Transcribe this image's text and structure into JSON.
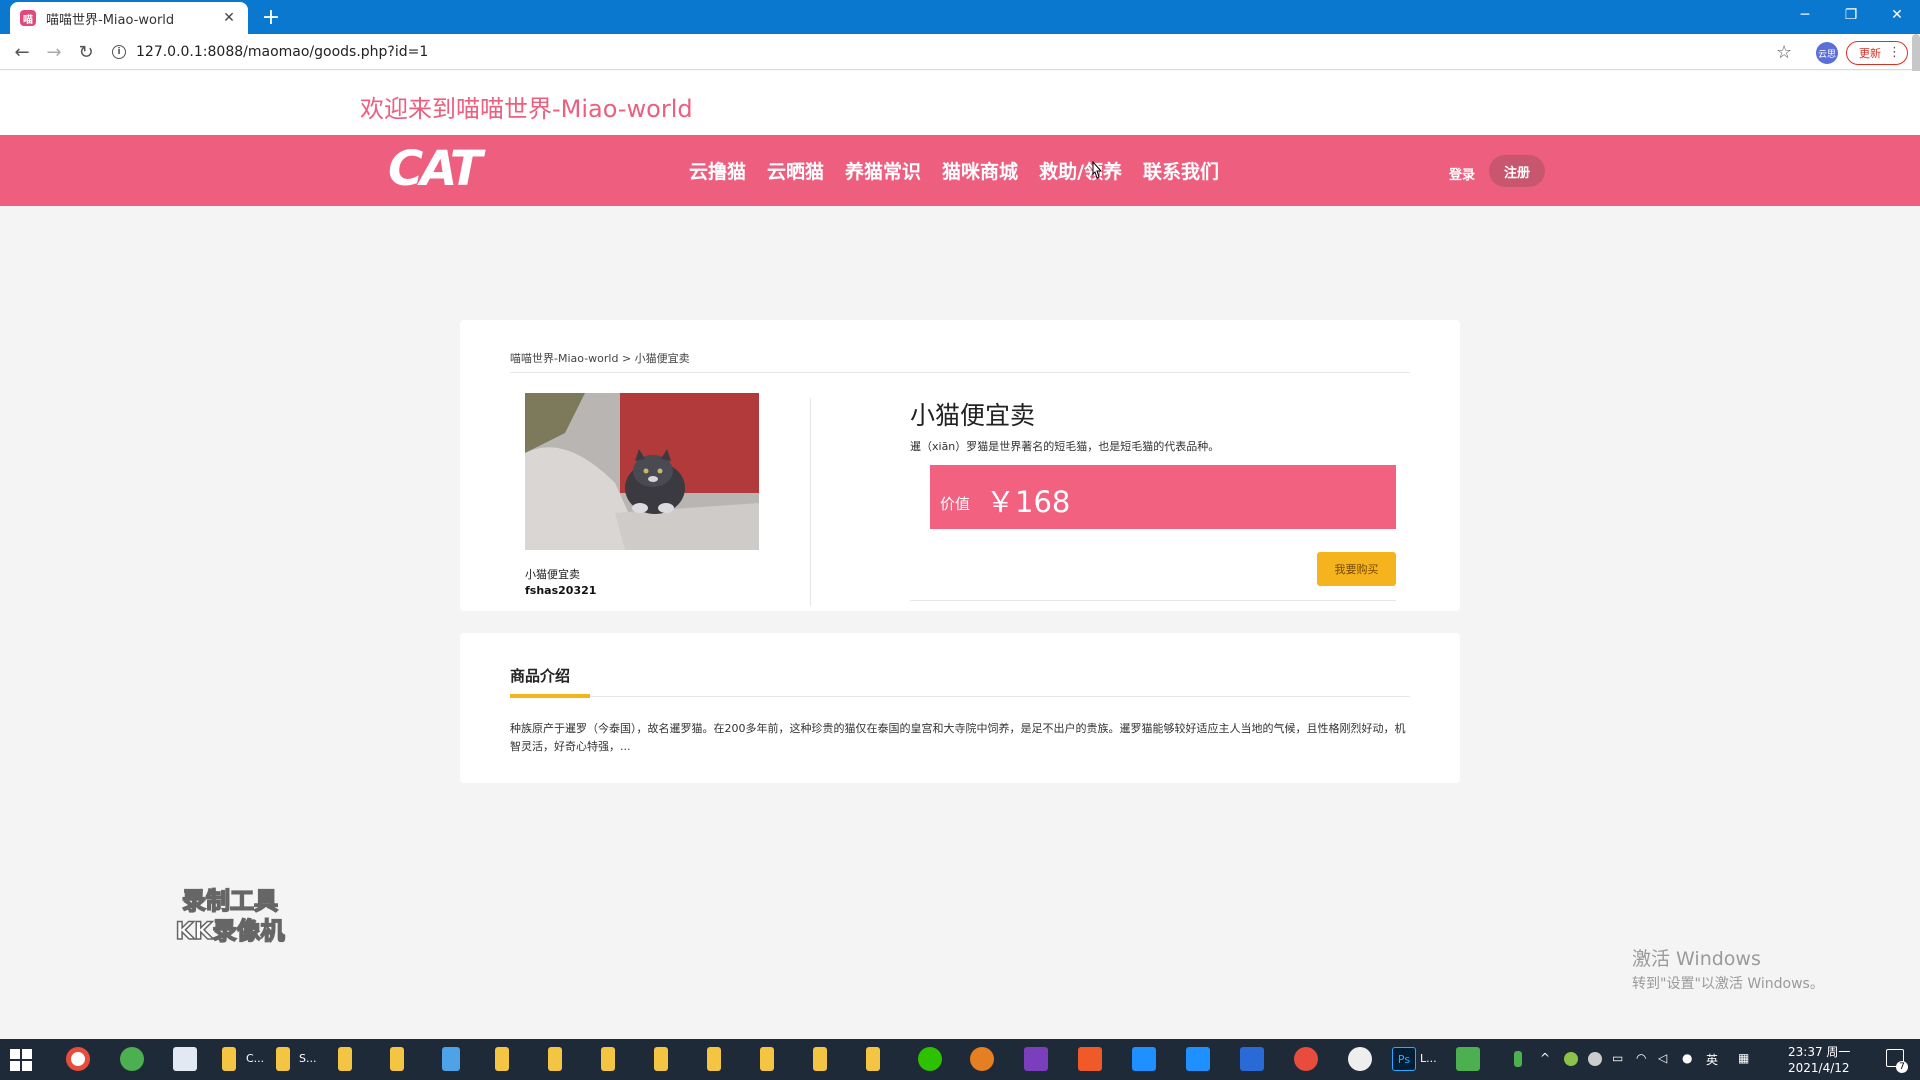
{
  "browser": {
    "tab_title": "喵喵世界-Miao-world",
    "tab_close": "✕",
    "new_tab": "+",
    "minimize": "─",
    "restore": "❐",
    "close": "✕",
    "back": "←",
    "forward": "→",
    "reload": "↻",
    "info": "i",
    "url": "127.0.0.1:8088/maomao/goods.php?id=1",
    "star": "☆",
    "profile_label": "云思",
    "update_label": "更新",
    "menu": "⋮"
  },
  "page": {
    "welcome": "欢迎来到喵喵世界-Miao-world",
    "logo": "CAT",
    "nav": [
      {
        "label": "云撸猫"
      },
      {
        "label": "云晒猫"
      },
      {
        "label": "养猫常识"
      },
      {
        "label": "猫咪商城"
      },
      {
        "label": "救助/领养"
      },
      {
        "label": "联系我们"
      }
    ],
    "login": "登录",
    "register": "注册"
  },
  "goods": {
    "breadcrumb": "喵喵世界-Miao-world > 小猫便宜卖",
    "image_caption": "小猫便宜卖",
    "seller": "fshas20321",
    "title": "小猫便宜卖",
    "description": "暹（xiān）罗猫是世界著名的短毛猫，也是短毛猫的代表品种。",
    "price_label": "价值",
    "price": "￥168",
    "buy_button": "我要购买"
  },
  "intro": {
    "title": "商品介绍",
    "text": "种族原产于暹罗（今泰国），故名暹罗猫。在200多年前，这种珍贵的猫仅在泰国的皇宫和大寺院中饲养，是足不出户的贵族。暹罗猫能够较好适应主人当地的气候，且性格刚烈好动，机智灵活，好奇心特强，..."
  },
  "overlay": {
    "watermark_line1": "录制工具",
    "watermark_line2": "KK录像机",
    "activate_title": "激活 Windows",
    "activate_sub": "转到\"设置\"以激活 Windows。"
  },
  "taskbar": {
    "label_c": "C...",
    "label_s": "S...",
    "ps_label": "Ps",
    "ps_extra": "L...",
    "ime": "英",
    "clock_time": "23:37 周一",
    "clock_date": "2021/4/12",
    "notif_count": "7"
  },
  "colors": {
    "accent_pink": "#ee5f7f",
    "price_pink": "#f2617f",
    "buy_yellow": "#f5b31e",
    "browser_blue": "#0b78d0"
  }
}
